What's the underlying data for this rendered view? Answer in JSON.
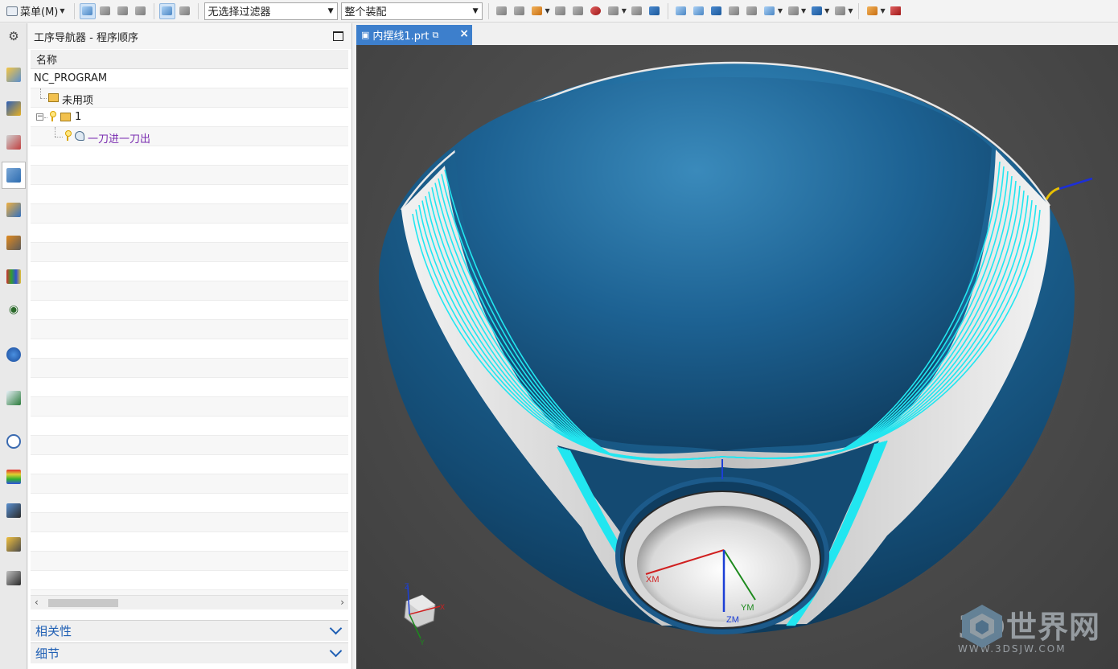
{
  "toolbar": {
    "menu_label": "菜单(M)",
    "selection_filter": "无选择过滤器",
    "assembly_scope": "整个装配"
  },
  "navigator": {
    "title": "工序导航器 - 程序顺序",
    "column_name": "名称",
    "rows": [
      {
        "label": "NC_PROGRAM"
      },
      {
        "label": "未用项"
      },
      {
        "label": "1"
      },
      {
        "label": "一刀进一刀出"
      }
    ],
    "section_dependencies": "相关性",
    "section_details": "细节"
  },
  "graphics": {
    "tab_label": "内摆线1.prt",
    "axes": {
      "xm": "XM",
      "ym": "YM",
      "zm": "ZM",
      "x": "X",
      "y": "Y",
      "z": "Z"
    },
    "watermark_text": "3D世界网",
    "watermark_url": "WWW.3DSJW.COM"
  },
  "colors": {
    "part_blue": "#1d5a86",
    "toolpath": "#22e6f0",
    "tab_active": "#3d7fcc",
    "section_label": "#1f5fb4",
    "xm_axis": "#d02020",
    "ym_axis": "#1d8a1d",
    "zm_axis": "#1c3fd6"
  }
}
